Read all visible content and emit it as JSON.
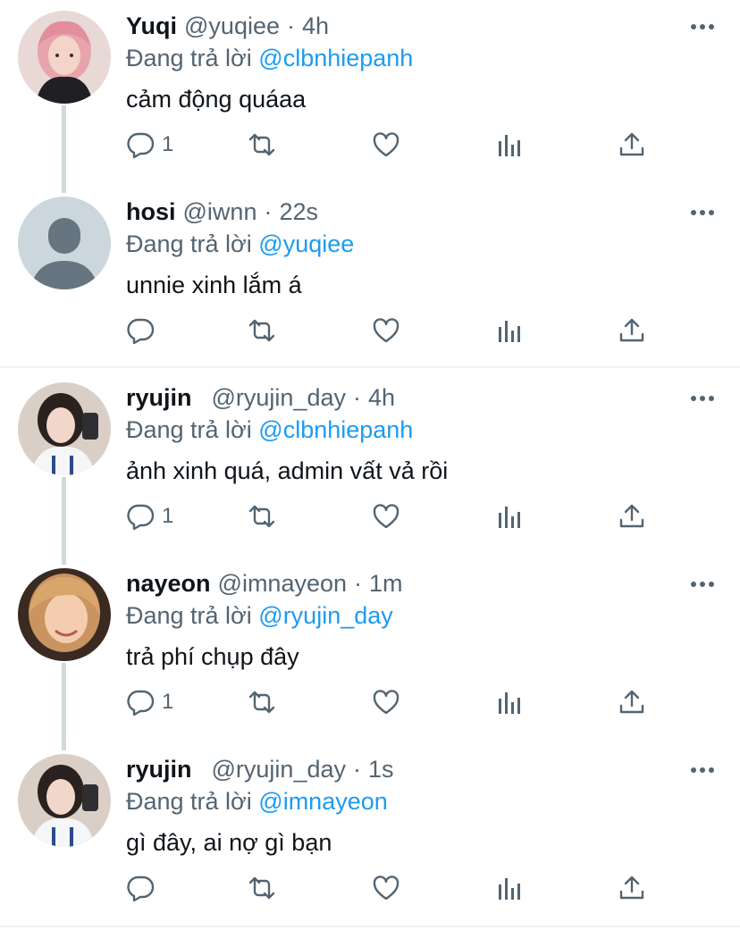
{
  "reply_prefix": "Đang trả lời",
  "colors": {
    "accent": "#1d9bf0",
    "muted": "#536471",
    "text": "#0f1419",
    "thread_line": "#cfd9de"
  },
  "tweets": [
    {
      "name": "Yuqi",
      "handle": "@yuqiee",
      "time": "4h",
      "reply_to": "@clbnhiepanh",
      "text": "cảm động quáaa",
      "reply_count": "1",
      "avatar": "photo"
    },
    {
      "name": "hosi",
      "handle": "@iwnn",
      "time": "22s",
      "reply_to": "@yuqiee",
      "text": "unnie xinh lắm á",
      "reply_count": "",
      "avatar": "default-avatar-icon"
    },
    {
      "name": "ryujin",
      "handle": "@ryujin_day",
      "time": "4h",
      "reply_to": "@clbnhiepanh",
      "text": "ảnh xinh quá, admin vất vả rồi",
      "reply_count": "1",
      "avatar": "photo"
    },
    {
      "name": "nayeon",
      "handle": "@imnayeon",
      "time": "1m",
      "reply_to": "@ryujin_day",
      "text": "trả phí chụp đây",
      "reply_count": "1",
      "avatar": "photo"
    },
    {
      "name": "ryujin",
      "handle": "@ryujin_day",
      "time": "1s",
      "reply_to": "@imnayeon",
      "text": "gì đây, ai nợ gì bạn",
      "reply_count": "",
      "avatar": "photo"
    }
  ]
}
